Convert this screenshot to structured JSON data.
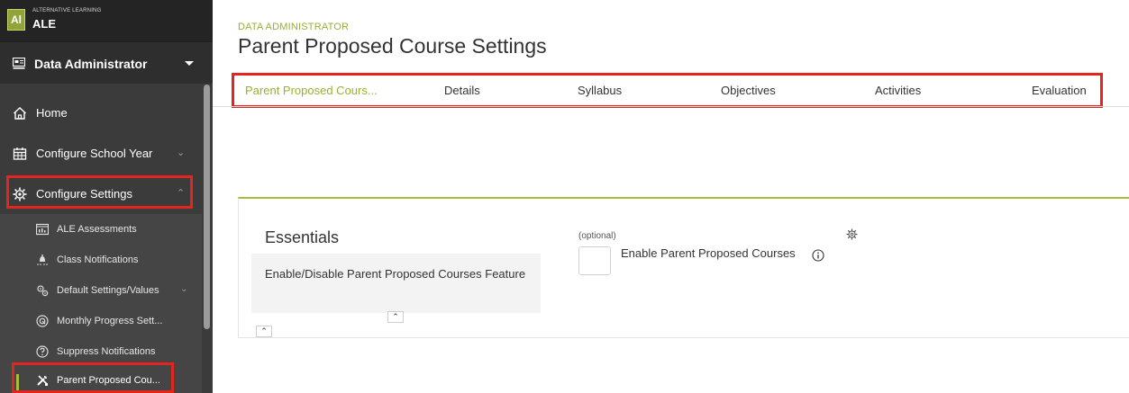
{
  "logo": {
    "badge": "Al",
    "small": "ALTERNATIVE LEARNING",
    "big": "ALE"
  },
  "role": {
    "label": "Data Administrator"
  },
  "nav": {
    "home": "Home",
    "configure_school_year": "Configure School Year",
    "configure_settings": "Configure Settings"
  },
  "subnav": [
    {
      "label": "ALE Assessments"
    },
    {
      "label": "Class Notifications"
    },
    {
      "label": "Default Settings/Values"
    },
    {
      "label": "Monthly Progress Sett..."
    },
    {
      "label": "Suppress Notifications"
    },
    {
      "label": "Parent Proposed Cou..."
    }
  ],
  "header": {
    "subtitle": "DATA ADMINISTRATOR",
    "title": "Parent Proposed Course Settings"
  },
  "tabs": [
    {
      "label": "Parent Proposed Cours...",
      "active": true
    },
    {
      "label": "Details"
    },
    {
      "label": "Syllabus"
    },
    {
      "label": "Objectives"
    },
    {
      "label": "Activities"
    },
    {
      "label": "Evaluation"
    }
  ],
  "essentials": {
    "title": "Essentials",
    "description": "Enable/Disable Parent Proposed Courses Feature",
    "optional": "(optional)",
    "checkbox_label": "Enable Parent Proposed Courses",
    "checkbox_checked": false
  },
  "colors": {
    "accent": "#98b034",
    "highlight": "#e3261d",
    "sidebar": "#3b3b3b"
  }
}
